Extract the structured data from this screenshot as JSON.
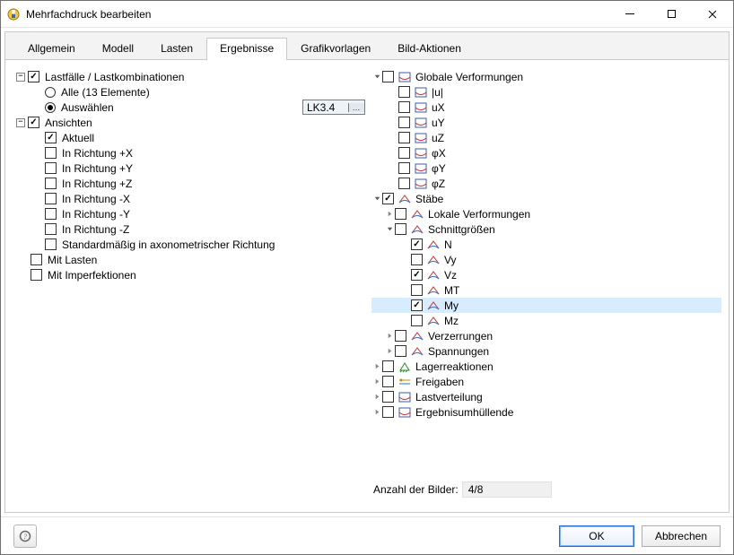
{
  "window": {
    "title": "Mehrfachdruck bearbeiten"
  },
  "tabs": {
    "allgemein": "Allgemein",
    "modell": "Modell",
    "lasten": "Lasten",
    "ergebnisse": "Ergebnisse",
    "grafikvorlagen": "Grafikvorlagen",
    "bild_aktionen": "Bild-Aktionen"
  },
  "left": {
    "lastfaelle": "Lastfälle / Lastkombinationen",
    "alle": "Alle (13 Elemente)",
    "auswaehlen": "Auswählen",
    "combo_value": "LK3.4",
    "ansichten": "Ansichten",
    "aktuell": "Aktuell",
    "rx": "In Richtung +X",
    "ry": "In Richtung +Y",
    "rz": "In Richtung +Z",
    "rnx": "In Richtung -X",
    "rny": "In Richtung -Y",
    "rnz": "In Richtung -Z",
    "axon": "Standardmäßig in axonometrischer Richtung",
    "mit_lasten": "Mit Lasten",
    "mit_imperf": "Mit Imperfektionen"
  },
  "right": {
    "globale": "Globale Verformungen",
    "u": "|u|",
    "ux": "uX",
    "uy": "uY",
    "uz": "uZ",
    "phix": "φX",
    "phiy": "φY",
    "phiz": "φZ",
    "staebe": "Stäbe",
    "lokale": "Lokale Verformungen",
    "schnitt": "Schnittgrößen",
    "n": "N",
    "vy": "Vy",
    "vz": "Vz",
    "mt": "MT",
    "my": "My",
    "mz": "Mz",
    "verzerr": "Verzerrungen",
    "spannungen": "Spannungen",
    "lagerreak": "Lagerreaktionen",
    "freigaben": "Freigaben",
    "lastvert": "Lastverteilung",
    "ergebnum": "Ergebnisumhüllende"
  },
  "count": {
    "label": "Anzahl der Bilder:",
    "value": "4/8"
  },
  "buttons": {
    "ok": "OK",
    "cancel": "Abbrechen"
  }
}
